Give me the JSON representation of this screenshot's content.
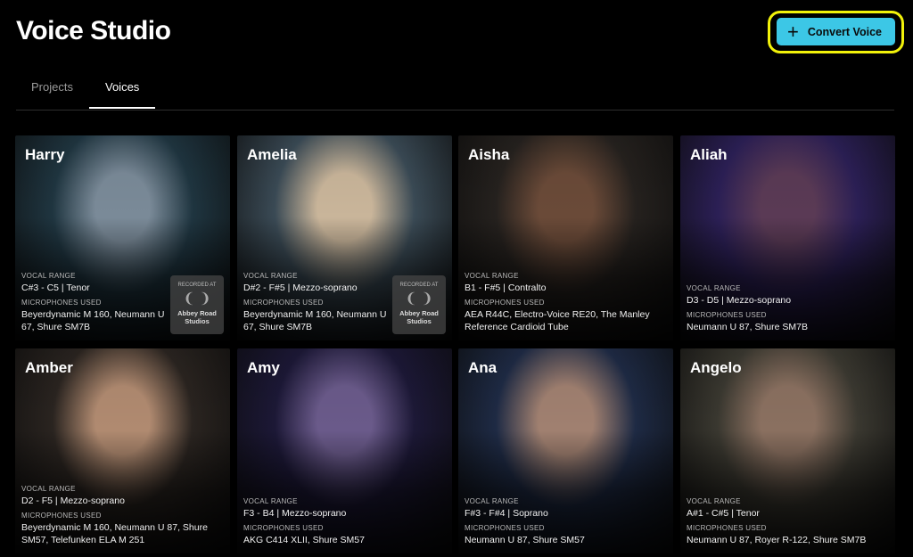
{
  "header": {
    "title": "Voice Studio",
    "convert_label": "Convert Voice"
  },
  "tabs": [
    {
      "label": "Projects"
    },
    {
      "label": "Voices"
    }
  ],
  "labels": {
    "vocal_range": "VOCAL RANGE",
    "microphones": "MICROPHONES USED",
    "recorded_at": "RECORDED AT"
  },
  "voices": [
    {
      "name": "Harry",
      "vocal_range": "C#3 - C5 | Tenor",
      "microphones": "Beyerdynamic M 160, Neumann U 67, Shure SM7B",
      "studio": "Abbey Road Studios",
      "bg": "#1f3540",
      "skin": "#7a8a98"
    },
    {
      "name": "Amelia",
      "vocal_range": "D#2 - F#5 | Mezzo-soprano",
      "microphones": "Beyerdynamic M 160, Neumann U 67, Shure SM7B",
      "studio": "Abbey Road Studios",
      "bg": "#3a4a55",
      "skin": "#c9b59a"
    },
    {
      "name": "Aisha",
      "vocal_range": "B1 - F#5 | Contralto",
      "microphones": "AEA R44C, Electro-Voice RE20, The Manley Reference Cardioid Tube",
      "bg": "#25211e",
      "skin": "#6a4a38"
    },
    {
      "name": "Aliah",
      "vocal_range": "D3 - D5 | Mezzo-soprano",
      "microphones": "Neumann U 87, Shure SM7B",
      "bg": "#2b1f55",
      "skin": "#5a3a55"
    },
    {
      "name": "Amber",
      "vocal_range": "D2 - F5 | Mezzo-soprano",
      "microphones": "Beyerdynamic M 160, Neumann U 87, Shure SM57, Telefunken ELA M 251",
      "bg": "#2a2420",
      "skin": "#b08a70"
    },
    {
      "name": "Amy",
      "vocal_range": "F3 - B4 | Mezzo-soprano",
      "microphones": "AKG C414 XLII, Shure SM57",
      "bg": "#1c1836",
      "skin": "#6a5a8a"
    },
    {
      "name": "Ana",
      "vocal_range": "F#3 - F#4 | Soprano",
      "microphones": "Neumann U 87, Shure SM57",
      "bg": "#1e2a44",
      "skin": "#a08070"
    },
    {
      "name": "Angelo",
      "vocal_range": "A#1 - C#5 | Tenor",
      "microphones": "Neumann U 87, Royer R-122, Shure SM7B",
      "bg": "#3a3830",
      "skin": "#8a7060"
    }
  ]
}
